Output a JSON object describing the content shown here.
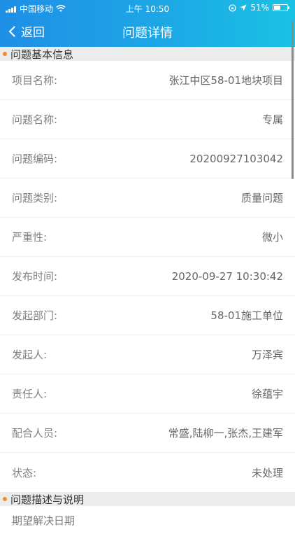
{
  "status_bar": {
    "carrier": "中国移动",
    "time": "上午 10:50",
    "battery_percent": "51%",
    "battery_level": 0.51,
    "icons": [
      "signal-icon",
      "wifi-icon",
      "orientation-lock-icon",
      "location-icon",
      "battery-icon"
    ]
  },
  "nav": {
    "back_label": "返回",
    "title": "问题详情",
    "colors": {
      "gradient_start": "#1e8fe6",
      "gradient_end": "#19c2e4"
    }
  },
  "sections": {
    "basic": {
      "title": "问题基本信息",
      "accent": "#f28a2e",
      "rows": [
        {
          "label": "项目名称:",
          "value": "张江中区58-01地块项目"
        },
        {
          "label": "问题名称:",
          "value": "专属"
        },
        {
          "label": "问题编码:",
          "value": "20200927103042"
        },
        {
          "label": "问题类别:",
          "value": "质量问题"
        },
        {
          "label": "严重性:",
          "value": "微小"
        },
        {
          "label": "发布时间:",
          "value": "2020-09-27 10:30:42"
        },
        {
          "label": "发起部门:",
          "value": "58-01施工单位"
        },
        {
          "label": "发起人:",
          "value": "万泽宾"
        },
        {
          "label": "责任人:",
          "value": "徐蕴宇"
        },
        {
          "label": "配合人员:",
          "value": "常盛,陆柳一,张杰,王建军"
        },
        {
          "label": "状态:",
          "value": "未处理"
        }
      ]
    },
    "description": {
      "title": "问题描述与说明",
      "partial_label": "期望解决日期"
    }
  }
}
